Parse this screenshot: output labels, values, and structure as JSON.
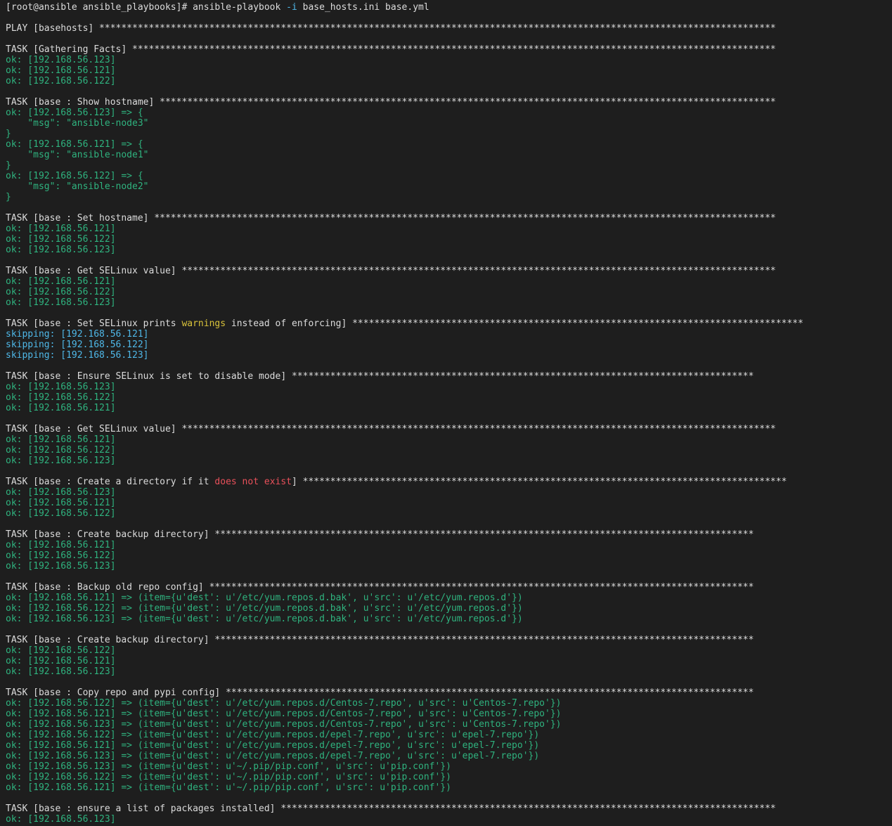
{
  "colors": {
    "background": "#1e1e1e",
    "default": "#dcdcdc",
    "ok": "#2fb37f",
    "skip": "#4fb8e8",
    "warn": "#d8c23a",
    "red": "#e8505a"
  },
  "terminal": {
    "lines": [
      [
        {
          "t": "[root@ansible ansible_playbooks]# ansible-playbook ",
          "c": "default"
        },
        {
          "t": "-i",
          "c": "flag"
        },
        {
          "t": " base_hosts.ini base.yml",
          "c": "default"
        }
      ],
      [],
      [
        {
          "t": "PLAY [basehosts] ***************************************************************************************************************************",
          "c": "default"
        }
      ],
      [],
      [
        {
          "t": "TASK [Gathering Facts] *********************************************************************************************************************",
          "c": "default"
        }
      ],
      [
        {
          "t": "ok: [192.168.56.123]",
          "c": "ok"
        }
      ],
      [
        {
          "t": "ok: [192.168.56.121]",
          "c": "ok"
        }
      ],
      [
        {
          "t": "ok: [192.168.56.122]",
          "c": "ok"
        }
      ],
      [],
      [
        {
          "t": "TASK [base : Show hostname] ****************************************************************************************************************",
          "c": "default"
        }
      ],
      [
        {
          "t": "ok: [192.168.56.123] => {",
          "c": "ok"
        }
      ],
      [
        {
          "t": "    \"msg\": \"ansible-node3\"",
          "c": "ok"
        }
      ],
      [
        {
          "t": "}",
          "c": "ok"
        }
      ],
      [
        {
          "t": "ok: [192.168.56.121] => {",
          "c": "ok"
        }
      ],
      [
        {
          "t": "    \"msg\": \"ansible-node1\"",
          "c": "ok"
        }
      ],
      [
        {
          "t": "}",
          "c": "ok"
        }
      ],
      [
        {
          "t": "ok: [192.168.56.122] => {",
          "c": "ok"
        }
      ],
      [
        {
          "t": "    \"msg\": \"ansible-node2\"",
          "c": "ok"
        }
      ],
      [
        {
          "t": "}",
          "c": "ok"
        }
      ],
      [],
      [
        {
          "t": "TASK [base : Set hostname] *****************************************************************************************************************",
          "c": "default"
        }
      ],
      [
        {
          "t": "ok: [192.168.56.121]",
          "c": "ok"
        }
      ],
      [
        {
          "t": "ok: [192.168.56.122]",
          "c": "ok"
        }
      ],
      [
        {
          "t": "ok: [192.168.56.123]",
          "c": "ok"
        }
      ],
      [],
      [
        {
          "t": "TASK [base : Get SELinux value] ************************************************************************************************************",
          "c": "default"
        }
      ],
      [
        {
          "t": "ok: [192.168.56.121]",
          "c": "ok"
        }
      ],
      [
        {
          "t": "ok: [192.168.56.122]",
          "c": "ok"
        }
      ],
      [
        {
          "t": "ok: [192.168.56.123]",
          "c": "ok"
        }
      ],
      [],
      [
        {
          "t": "TASK [base : Set SELinux prints ",
          "c": "default"
        },
        {
          "t": "warnings",
          "c": "warn"
        },
        {
          "t": " instead of enforcing] **********************************************************************************",
          "c": "default"
        }
      ],
      [
        {
          "t": "skipping: [192.168.56.121]",
          "c": "skip"
        }
      ],
      [
        {
          "t": "skipping: [192.168.56.122]",
          "c": "skip"
        }
      ],
      [
        {
          "t": "skipping: [192.168.56.123]",
          "c": "skip"
        }
      ],
      [],
      [
        {
          "t": "TASK [base : Ensure SELinux is set to disable mode] ************************************************************************************",
          "c": "default"
        }
      ],
      [
        {
          "t": "ok: [192.168.56.123]",
          "c": "ok"
        }
      ],
      [
        {
          "t": "ok: [192.168.56.122]",
          "c": "ok"
        }
      ],
      [
        {
          "t": "ok: [192.168.56.121]",
          "c": "ok"
        }
      ],
      [],
      [
        {
          "t": "TASK [base : Get SELinux value] ************************************************************************************************************",
          "c": "default"
        }
      ],
      [
        {
          "t": "ok: [192.168.56.121]",
          "c": "ok"
        }
      ],
      [
        {
          "t": "ok: [192.168.56.122]",
          "c": "ok"
        }
      ],
      [
        {
          "t": "ok: [192.168.56.123]",
          "c": "ok"
        }
      ],
      [],
      [
        {
          "t": "TASK [base : Create a directory if it ",
          "c": "default"
        },
        {
          "t": "does not exist",
          "c": "red"
        },
        {
          "t": "] ****************************************************************************************",
          "c": "default"
        }
      ],
      [
        {
          "t": "ok: [192.168.56.123]",
          "c": "ok"
        }
      ],
      [
        {
          "t": "ok: [192.168.56.121]",
          "c": "ok"
        }
      ],
      [
        {
          "t": "ok: [192.168.56.122]",
          "c": "ok"
        }
      ],
      [],
      [
        {
          "t": "TASK [base : Create backup directory] **************************************************************************************************",
          "c": "default"
        }
      ],
      [
        {
          "t": "ok: [192.168.56.121]",
          "c": "ok"
        }
      ],
      [
        {
          "t": "ok: [192.168.56.122]",
          "c": "ok"
        }
      ],
      [
        {
          "t": "ok: [192.168.56.123]",
          "c": "ok"
        }
      ],
      [],
      [
        {
          "t": "TASK [base : Backup old repo config] ***************************************************************************************************",
          "c": "default"
        }
      ],
      [
        {
          "t": "ok: [192.168.56.121] => (item={u'dest': u'/etc/yum.repos.d.bak', u'src': u'/etc/yum.repos.d'})",
          "c": "ok"
        }
      ],
      [
        {
          "t": "ok: [192.168.56.122] => (item={u'dest': u'/etc/yum.repos.d.bak', u'src': u'/etc/yum.repos.d'})",
          "c": "ok"
        }
      ],
      [
        {
          "t": "ok: [192.168.56.123] => (item={u'dest': u'/etc/yum.repos.d.bak', u'src': u'/etc/yum.repos.d'})",
          "c": "ok"
        }
      ],
      [],
      [
        {
          "t": "TASK [base : Create backup directory] **************************************************************************************************",
          "c": "default"
        }
      ],
      [
        {
          "t": "ok: [192.168.56.122]",
          "c": "ok"
        }
      ],
      [
        {
          "t": "ok: [192.168.56.121]",
          "c": "ok"
        }
      ],
      [
        {
          "t": "ok: [192.168.56.123]",
          "c": "ok"
        }
      ],
      [],
      [
        {
          "t": "TASK [base : Copy repo and pypi config] ************************************************************************************************",
          "c": "default"
        }
      ],
      [
        {
          "t": "ok: [192.168.56.122] => (item={u'dest': u'/etc/yum.repos.d/Centos-7.repo', u'src': u'Centos-7.repo'})",
          "c": "ok"
        }
      ],
      [
        {
          "t": "ok: [192.168.56.121] => (item={u'dest': u'/etc/yum.repos.d/Centos-7.repo', u'src': u'Centos-7.repo'})",
          "c": "ok"
        }
      ],
      [
        {
          "t": "ok: [192.168.56.123] => (item={u'dest': u'/etc/yum.repos.d/Centos-7.repo', u'src': u'Centos-7.repo'})",
          "c": "ok"
        }
      ],
      [
        {
          "t": "ok: [192.168.56.122] => (item={u'dest': u'/etc/yum.repos.d/epel-7.repo', u'src': u'epel-7.repo'})",
          "c": "ok"
        }
      ],
      [
        {
          "t": "ok: [192.168.56.121] => (item={u'dest': u'/etc/yum.repos.d/epel-7.repo', u'src': u'epel-7.repo'})",
          "c": "ok"
        }
      ],
      [
        {
          "t": "ok: [192.168.56.123] => (item={u'dest': u'/etc/yum.repos.d/epel-7.repo', u'src': u'epel-7.repo'})",
          "c": "ok"
        }
      ],
      [
        {
          "t": "ok: [192.168.56.123] => (item={u'dest': u'~/.pip/pip.conf', u'src': u'pip.conf'})",
          "c": "ok"
        }
      ],
      [
        {
          "t": "ok: [192.168.56.122] => (item={u'dest': u'~/.pip/pip.conf', u'src': u'pip.conf'})",
          "c": "ok"
        }
      ],
      [
        {
          "t": "ok: [192.168.56.121] => (item={u'dest': u'~/.pip/pip.conf', u'src': u'pip.conf'})",
          "c": "ok"
        }
      ],
      [],
      [
        {
          "t": "TASK [base : ensure a list of packages installed] ******************************************************************************************",
          "c": "default"
        }
      ],
      [
        {
          "t": "ok: [192.168.56.123]",
          "c": "ok"
        }
      ]
    ]
  }
}
